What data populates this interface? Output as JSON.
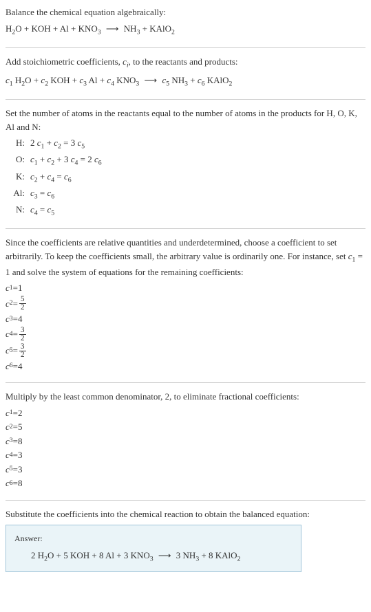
{
  "section1": {
    "title": "Balance the chemical equation algebraically:",
    "equation_left": "H",
    "equation": "H₂O + KOH + Al + KNO₃  ⟶  NH₃ + KAlO₂"
  },
  "section2": {
    "title_part1": "Add stoichiometric coefficients, ",
    "title_ci": "c",
    "title_i": "i",
    "title_part2": ", to the reactants and products:",
    "equation": "c₁ H₂O + c₂ KOH + c₃ Al + c₄ KNO₃  ⟶  c₅ NH₃ + c₆ KAlO₂"
  },
  "section3": {
    "title": "Set the number of atoms in the reactants equal to the number of atoms in the products for H, O, K, Al and N:",
    "atoms": [
      {
        "label": "H:",
        "eq": "2 c₁ + c₂ = 3 c₅"
      },
      {
        "label": "O:",
        "eq": "c₁ + c₂ + 3 c₄ = 2 c₆"
      },
      {
        "label": "K:",
        "eq": "c₂ + c₄ = c₆"
      },
      {
        "label": "Al:",
        "eq": "c₃ = c₆"
      },
      {
        "label": "N:",
        "eq": "c₄ = c₅"
      }
    ]
  },
  "section4": {
    "title": "Since the coefficients are relative quantities and underdetermined, choose a coefficient to set arbitrarily. To keep the coefficients small, the arbitrary value is ordinarily one. For instance, set c₁ = 1 and solve the system of equations for the remaining coefficients:",
    "coefs": [
      {
        "var": "c₁",
        "val": "1",
        "frac": false
      },
      {
        "var": "c₂",
        "num": "5",
        "den": "2",
        "frac": true
      },
      {
        "var": "c₃",
        "val": "4",
        "frac": false
      },
      {
        "var": "c₄",
        "num": "3",
        "den": "2",
        "frac": true
      },
      {
        "var": "c₅",
        "num": "3",
        "den": "2",
        "frac": true
      },
      {
        "var": "c₆",
        "val": "4",
        "frac": false
      }
    ]
  },
  "section5": {
    "title": "Multiply by the least common denominator, 2, to eliminate fractional coefficients:",
    "coefs": [
      {
        "var": "c₁",
        "val": "2"
      },
      {
        "var": "c₂",
        "val": "5"
      },
      {
        "var": "c₃",
        "val": "8"
      },
      {
        "var": "c₄",
        "val": "3"
      },
      {
        "var": "c₅",
        "val": "3"
      },
      {
        "var": "c₆",
        "val": "8"
      }
    ]
  },
  "section6": {
    "title": "Substitute the coefficients into the chemical reaction to obtain the balanced equation:"
  },
  "answer": {
    "label": "Answer:",
    "equation": "2 H₂O + 5 KOH + 8 Al + 3 KNO₃  ⟶  3 NH₃ + 8 KAlO₂"
  }
}
